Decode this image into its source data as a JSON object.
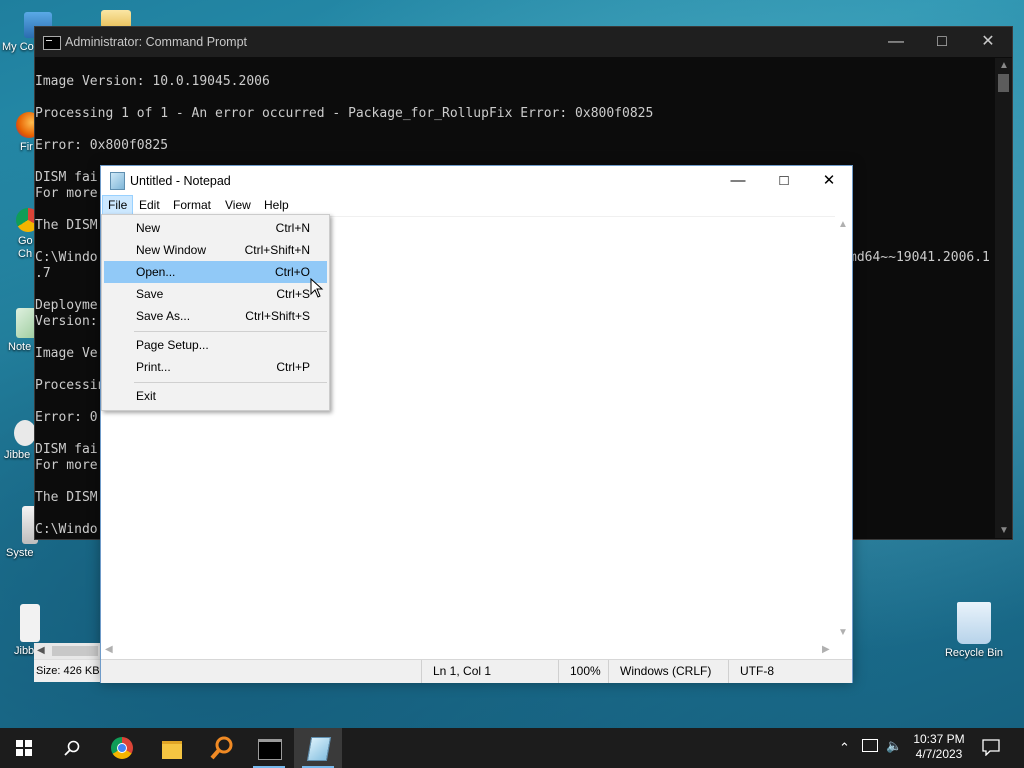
{
  "desktop": {
    "icons": [
      {
        "label": "My Co"
      },
      {
        "label": "Fir"
      },
      {
        "label": "Go\nCh"
      },
      {
        "label": "Note"
      },
      {
        "label": "Jibbe"
      },
      {
        "label": "Syste"
      },
      {
        "label": "Jibb"
      },
      {
        "label": "Recycle Bin"
      }
    ]
  },
  "cmd": {
    "title": "Administrator: Command Prompt",
    "lines": [
      "Image Version: 10.0.19045.2006",
      "Processing 1 of 1 - An error occurred - Package_for_RollupFix Error: 0x800f0825",
      "Error: 0x800f0825",
      "DISM fai",
      "For more",
      "The DISM",
      "C:\\Windo",
      ".7",
      "Deployme",
      "Version:",
      "Image Ve",
      "Processin",
      "Error: 0",
      "DISM fai",
      "For more",
      "The DISM",
      "C:\\Windo"
    ],
    "right_fragment": "md64~~19041.2006.1",
    "status_text": "Size: 426 KB,"
  },
  "notepad": {
    "title": "Untitled - Notepad",
    "menu": [
      "File",
      "Edit",
      "Format",
      "View",
      "Help"
    ],
    "status": {
      "position": "Ln 1, Col 1",
      "zoom": "100%",
      "line_endings": "Windows (CRLF)",
      "encoding": "UTF-8"
    }
  },
  "file_menu": {
    "items": [
      {
        "name": "New",
        "shortcut": "Ctrl+N"
      },
      {
        "name": "New Window",
        "shortcut": "Ctrl+Shift+N"
      },
      {
        "name": "Open...",
        "shortcut": "Ctrl+O"
      },
      {
        "name": "Save",
        "shortcut": "Ctrl+S"
      },
      {
        "name": "Save As...",
        "shortcut": "Ctrl+Shift+S"
      },
      {
        "name": "Page Setup...",
        "shortcut": ""
      },
      {
        "name": "Print...",
        "shortcut": "Ctrl+P"
      },
      {
        "name": "Exit",
        "shortcut": ""
      }
    ],
    "highlighted": "Open..."
  },
  "taskbar": {
    "apps": [
      "start-icon",
      "search-icon",
      "chrome-icon",
      "file-explorer-icon",
      "search-everything-icon",
      "command-prompt-icon",
      "notepad-icon"
    ],
    "time": "10:37 PM",
    "date": "4/7/2023"
  },
  "colors": {
    "menu_highlight": "#91c9f7",
    "menu_bar_active": "#cce8ff",
    "cmd_background": "#0c0c0c",
    "taskbar": "#1c1c1c"
  }
}
